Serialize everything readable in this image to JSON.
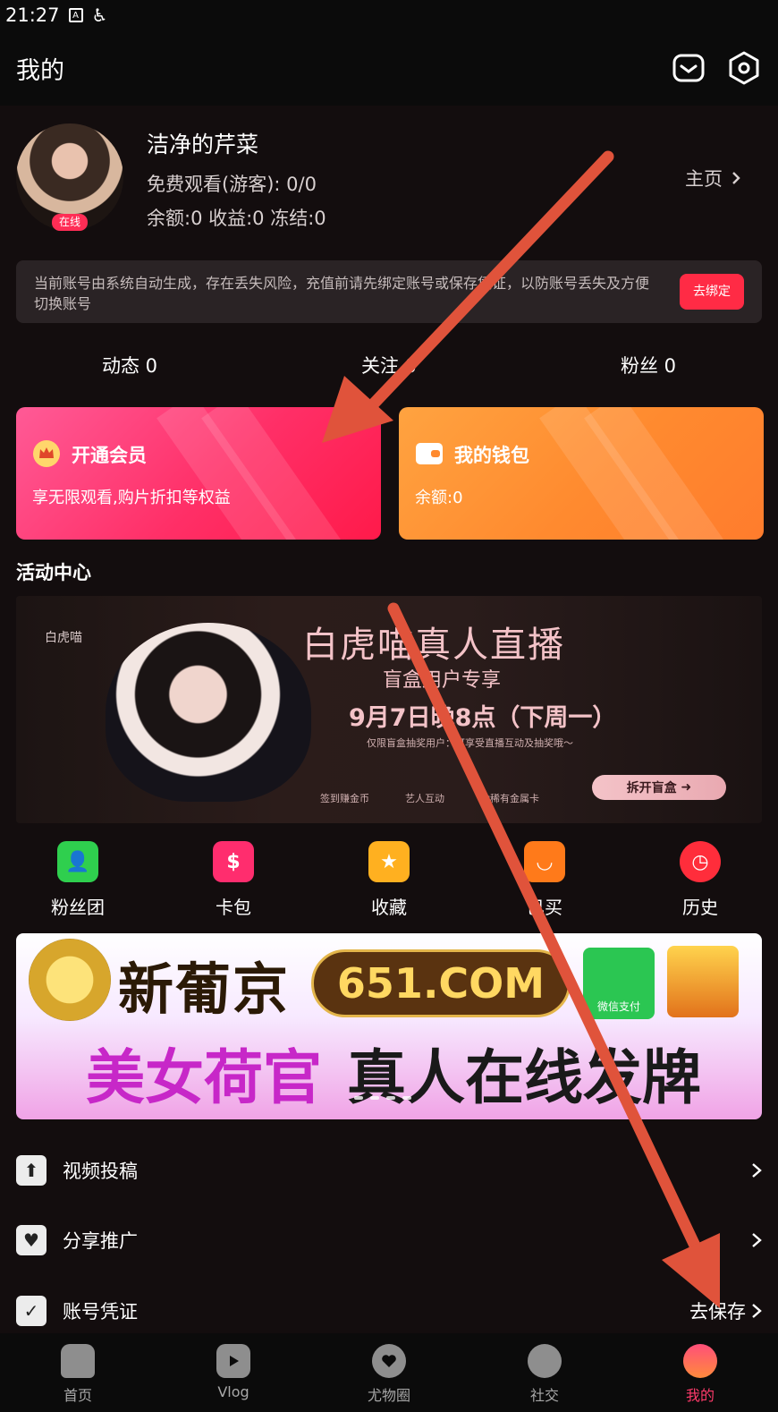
{
  "status": {
    "time": "21:27",
    "icons": [
      "a-icon",
      "accessibility-icon"
    ]
  },
  "header": {
    "title": "我的",
    "icons": [
      "message-icon",
      "settings-icon"
    ]
  },
  "profile": {
    "username": "洁净的芹菜",
    "free_view": "免费观看(游客): 0/0",
    "balance_line": "余额:0 收益:0 冻结:0",
    "online_badge": "在线",
    "homepage_label": "主页"
  },
  "notice": {
    "text": "当前账号由系统自动生成，存在丢失风险，充值前请先绑定账号或保存凭证，以防账号丢失及方便切换账号",
    "button": "去绑定"
  },
  "stats": [
    {
      "label": "动态 0"
    },
    {
      "label": "关注 0"
    },
    {
      "label": "粉丝 0"
    }
  ],
  "cards": {
    "vip": {
      "title": "开通会员",
      "subtitle": "享无限观看,购片折扣等权益"
    },
    "wallet": {
      "title": "我的钱包",
      "subtitle": "余额:0"
    }
  },
  "activity": {
    "title": "活动中心",
    "banner": {
      "left_text": "白虎喵",
      "headline": "白虎喵真人直播",
      "sub": "盲盒用户专享",
      "date": "9月7日晚8点（下周一）",
      "note": "仅限盲盒抽奖用户：可享受直播互动及抽奖哦～",
      "acts": [
        "签到赚金币",
        "艺人互动",
        "抽稀有金属卡"
      ],
      "button": "拆开盲盒"
    }
  },
  "quick_links": [
    {
      "label": "粉丝团",
      "icon": "fan-club-icon",
      "color": "#2fcf4e"
    },
    {
      "label": "卡包",
      "icon": "card-pack-icon",
      "color": "#ff2d6e"
    },
    {
      "label": "收藏",
      "icon": "favorites-icon",
      "color": "#ffb020"
    },
    {
      "label": "已买",
      "icon": "purchased-icon",
      "color": "#ff7a1a"
    },
    {
      "label": "历史",
      "icon": "history-icon",
      "color": "#ff2d3b"
    }
  ],
  "ad": {
    "brand": "新葡京",
    "url": "651.COM",
    "wechat": "微信支付",
    "slogan_pink": "美女荷官",
    "slogan_dark": "真人在线发牌"
  },
  "menu": [
    {
      "label": "视频投稿",
      "right": "",
      "icon": "upload-icon"
    },
    {
      "label": "分享推广",
      "right": "",
      "icon": "share-icon"
    },
    {
      "label": "账号凭证",
      "right": "去保存",
      "icon": "shield-icon"
    }
  ],
  "tabs": [
    {
      "label": "首页",
      "icon": "home-icon"
    },
    {
      "label": "Vlog",
      "icon": "play-icon"
    },
    {
      "label": "尤物圈",
      "icon": "heart-icon"
    },
    {
      "label": "社交",
      "icon": "planet-icon"
    },
    {
      "label": "我的",
      "icon": "profile-icon",
      "active": true
    }
  ],
  "colors": {
    "accent": "#ff2b45",
    "vip_card": "#ff2f67",
    "wallet_card": "#ff8a2f",
    "annotation_arrow": "#e0533b"
  }
}
